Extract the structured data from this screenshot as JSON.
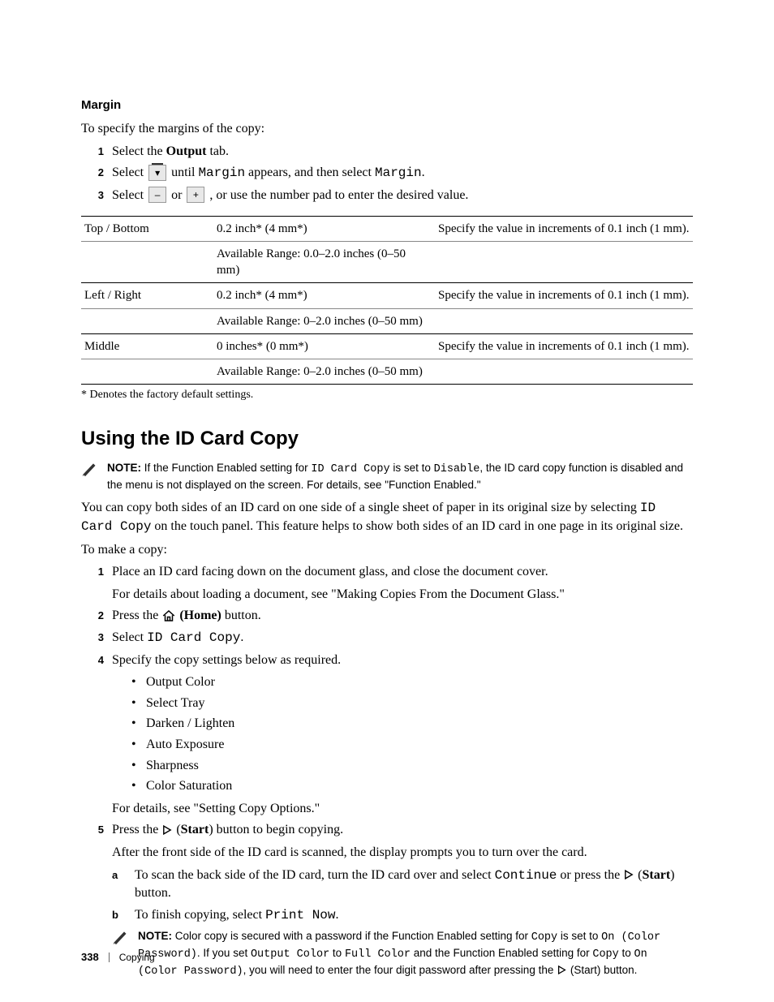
{
  "margin": {
    "heading": "Margin",
    "intro": "To specify the margins of the copy:",
    "steps": {
      "s1_pre": "Select the ",
      "s1_bold": "Output",
      "s1_post": " tab.",
      "s2_pre": "Select ",
      "s2_mid": " until ",
      "s2_mono1": "Margin",
      "s2_mid2": " appears, and then select ",
      "s2_mono2": "Margin",
      "s2_post": ".",
      "s3_pre": "Select ",
      "s3_or": " or ",
      "s3_post": " , or use the number pad to enter the desired value."
    },
    "table": [
      {
        "label": "Top / Bottom",
        "v1": "0.2 inch* (4 mm*)",
        "desc": "Specify the value in increments of 0.1 inch (1 mm).",
        "v2": "Available Range: 0.0–2.0 inches (0–50 mm)"
      },
      {
        "label": "Left / Right",
        "v1": "0.2 inch* (4 mm*)",
        "desc": "Specify the value in increments of 0.1 inch (1 mm).",
        "v2": "Available Range: 0–2.0 inches (0–50 mm)"
      },
      {
        "label": "Middle",
        "v1": "0 inches* (0 mm*)",
        "desc": "Specify the value in increments of 0.1 inch (1 mm).",
        "v2": "Available Range: 0–2.0 inches (0–50 mm)"
      }
    ],
    "footnote": "* Denotes the factory default settings."
  },
  "idcard": {
    "heading": "Using the ID Card Copy",
    "note1": {
      "bold": "NOTE: ",
      "t1": "If the Function Enabled setting for ",
      "m1": "ID Card Copy",
      "t2": " is set to ",
      "m2": "Disable",
      "t3": ", the ID card copy function is disabled and the menu is not displayed on the screen. For details, see \"Function Enabled.\""
    },
    "para1_a": "You can copy both sides of an ID card on one side of a single sheet of paper in its original size by selecting ",
    "para1_m1": "ID Card Copy",
    "para1_b": " on the touch panel. This feature helps to show both sides of an ID card in one page in its original size.",
    "para2": "To make a copy:",
    "steps": {
      "s1a": "Place an ID card facing down on the document glass, and close the document cover.",
      "s1b": "For details about loading a document, see \"Making Copies From the Document Glass.\"",
      "s2_pre": "Press the ",
      "s2_bold": " (Home)",
      "s2_post": " button.",
      "s3_pre": "Select ",
      "s3_mono": "ID Card Copy",
      "s3_post": ".",
      "s4": "Specify the copy settings below as required.",
      "bullets": [
        "Output Color",
        "Select Tray",
        "Darken / Lighten",
        "Auto Exposure",
        "Sharpness",
        "Color Saturation"
      ],
      "s4_tail": "For details, see \"Setting Copy Options.\"",
      "s5_pre": "Press the ",
      "s5_bold": "Start",
      "s5_post": ") button to begin copying.",
      "s5_line2": "After the front side of the ID card is scanned, the display prompts you to turn over the card.",
      "sa_pre": "To scan the back side of the ID card, turn the ID card over and select ",
      "sa_mono": "Continue",
      "sa_mid": " or press the ",
      "sa_bold": "Start",
      "sa_post": ") button.",
      "sb_pre": "To finish copying, select ",
      "sb_mono": "Print Now",
      "sb_post": "."
    },
    "note2": {
      "bold": "NOTE: ",
      "t1": "Color copy is secured with a password if the Function Enabled setting for ",
      "m1": "Copy",
      "t2": " is set to ",
      "m2": "On (Color Password)",
      "t3": ". If you set ",
      "m3": "Output Color",
      "t4": " to ",
      "m4": "Full Color",
      "t5": " and the Function Enabled setting for ",
      "m5": "Copy",
      "t6": " to ",
      "m6": "On (Color Password)",
      "t7": ", you will need to enter the four digit password after pressing the ",
      "t8": " (Start) button."
    }
  },
  "footer": {
    "page": "338",
    "section": "Copying"
  }
}
